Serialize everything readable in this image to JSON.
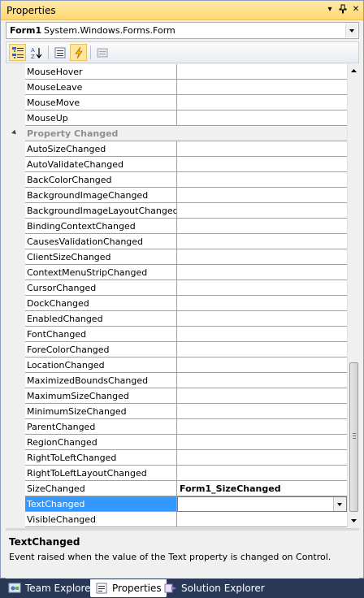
{
  "window": {
    "title": "Properties",
    "pin_glyph": "†",
    "menu_glyph": "▾",
    "close_glyph": "✕"
  },
  "selector": {
    "object_name": "Form1",
    "object_type": "System.Windows.Forms.Form"
  },
  "toolbar": {
    "buttons": [
      {
        "icon": "categorized-icon",
        "active": true
      },
      {
        "icon": "alphabetical-icon",
        "active": false
      },
      {
        "icon": "properties-icon",
        "active": false
      },
      {
        "icon": "events-icon",
        "active": true
      },
      {
        "icon": "property-pages-icon",
        "active": false
      }
    ]
  },
  "grid": {
    "rows": [
      {
        "name": "MouseHover",
        "value": ""
      },
      {
        "name": "MouseLeave",
        "value": ""
      },
      {
        "name": "MouseMove",
        "value": ""
      },
      {
        "name": "MouseUp",
        "value": ""
      },
      {
        "category": true,
        "name": "Property Changed"
      },
      {
        "name": "AutoSizeChanged",
        "value": ""
      },
      {
        "name": "AutoValidateChanged",
        "value": ""
      },
      {
        "name": "BackColorChanged",
        "value": ""
      },
      {
        "name": "BackgroundImageChanged",
        "value": ""
      },
      {
        "name": "BackgroundImageLayoutChanged",
        "value": ""
      },
      {
        "name": "BindingContextChanged",
        "value": ""
      },
      {
        "name": "CausesValidationChanged",
        "value": ""
      },
      {
        "name": "ClientSizeChanged",
        "value": ""
      },
      {
        "name": "ContextMenuStripChanged",
        "value": ""
      },
      {
        "name": "CursorChanged",
        "value": ""
      },
      {
        "name": "DockChanged",
        "value": ""
      },
      {
        "name": "EnabledChanged",
        "value": ""
      },
      {
        "name": "FontChanged",
        "value": ""
      },
      {
        "name": "ForeColorChanged",
        "value": ""
      },
      {
        "name": "LocationChanged",
        "value": ""
      },
      {
        "name": "MaximizedBoundsChanged",
        "value": ""
      },
      {
        "name": "MaximumSizeChanged",
        "value": ""
      },
      {
        "name": "MinimumSizeChanged",
        "value": ""
      },
      {
        "name": "ParentChanged",
        "value": ""
      },
      {
        "name": "RegionChanged",
        "value": ""
      },
      {
        "name": "RightToLeftChanged",
        "value": ""
      },
      {
        "name": "RightToLeftLayoutChanged",
        "value": ""
      },
      {
        "name": "SizeChanged",
        "value": "Form1_SizeChanged"
      },
      {
        "name": "TextChanged",
        "value": "",
        "selected": true
      },
      {
        "name": "VisibleChanged",
        "value": ""
      }
    ]
  },
  "description": {
    "title": "TextChanged",
    "text": "Event raised when the value of the Text property is changed on Control."
  },
  "tabs": [
    {
      "label": "Team Explorer",
      "icon": "team-explorer-icon",
      "active": false
    },
    {
      "label": "Properties",
      "icon": "properties-icon",
      "active": true
    },
    {
      "label": "Solution Explorer",
      "icon": "solution-explorer-icon",
      "active": false
    }
  ],
  "colors": {
    "selection": "#3399ff",
    "title_bar": "#ffd771",
    "frame": "#293955"
  }
}
